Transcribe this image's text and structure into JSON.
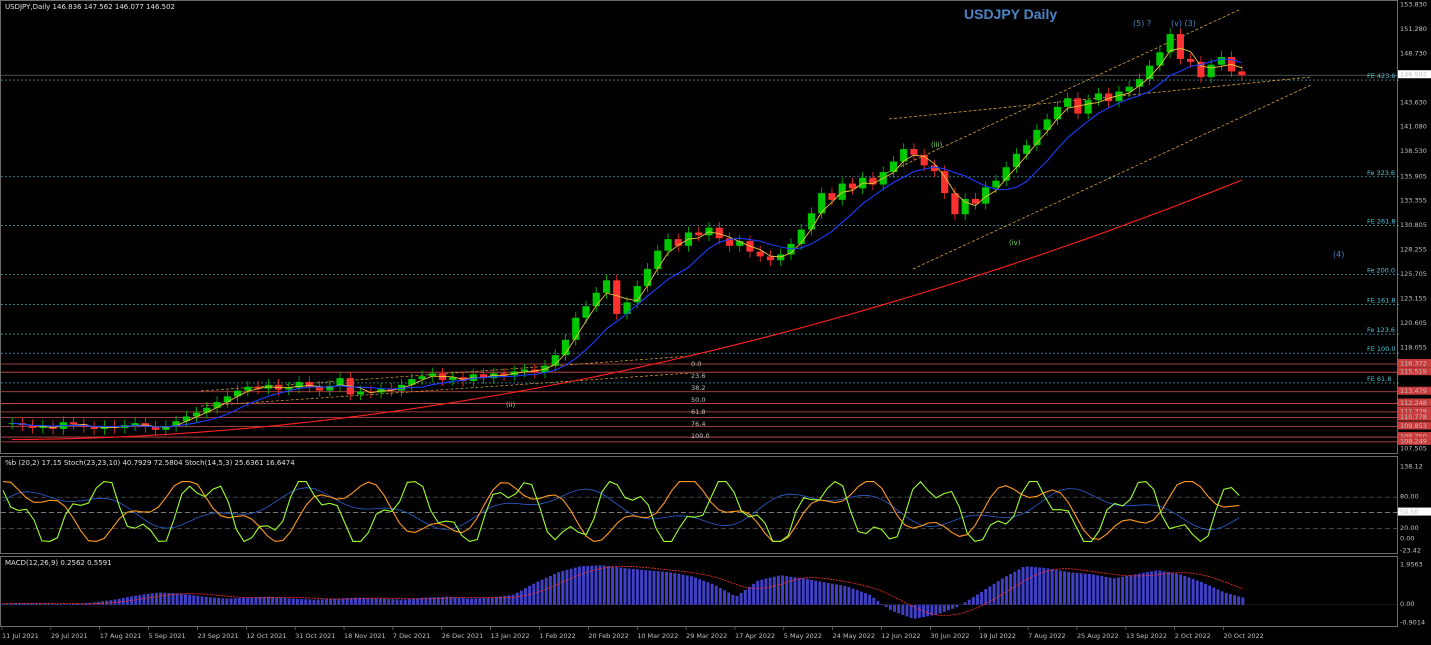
{
  "header": {
    "symbol_line": "USDJPY,Daily  146.836 147.562 146.077 146.502",
    "chart_title": "USDJPY Daily",
    "current_price": "146.502"
  },
  "stoch_header": "%b (20,2) 17.15  Stoch(23,23,10) 40.7929 72.5804  Stoch(14,5,3) 25.6361 16.6474",
  "macd_header": "MACD(12,26,9) 0.2562 0.5591",
  "wave_labels": [
    "(5) ?",
    "(v) (3)",
    "(iii)",
    "(iv)",
    "(4)",
    "(ii)"
  ],
  "colors": {
    "background": "#000000",
    "bull_candle": "#00c800",
    "bear_candle": "#ff3030",
    "ma_blue": "#1e3cff",
    "ma_red": "#ff2020",
    "ma_yellow": "#e8c43a",
    "fib_cyan": "#4fc7d8",
    "channel_orange": "#d9a43a",
    "stoch_green": "#9eff2e",
    "stoch_orange": "#ff9a1e",
    "macd_hist": "#4040c8"
  },
  "chart_data": [
    {
      "type": "candlestick",
      "title": "USDJPY Daily",
      "price_axis_ticks": [
        "153.830",
        "151.280",
        "148.730",
        "146.502",
        "143.630",
        "141.080",
        "138.530",
        "135.905",
        "133.355",
        "130.805",
        "128.255",
        "125.705",
        "123.155",
        "120.605",
        "118.055",
        "116.372",
        "115.519",
        "113.479",
        "112.248",
        "111.379",
        "110.778",
        "109.853",
        "108.750",
        "108.249",
        "107.505"
      ],
      "time_axis_ticks": [
        "11 Jul 2021",
        "29 Jul 2021",
        "17 Aug 2021",
        "5 Sep 2021",
        "23 Sep 2021",
        "12 Oct 2021",
        "31 Oct 2021",
        "18 Nov 2021",
        "7 Dec 2021",
        "26 Dec 2021",
        "13 Jan 2022",
        "1 Feb 2022",
        "20 Feb 2022",
        "10 Mar 2022",
        "29 Mar 2022",
        "17 Apr 2022",
        "5 May 2022",
        "24 May 2022",
        "12 Jun 2022",
        "30 Jun 2022",
        "19 Jul 2022",
        "7 Aug 2022",
        "25 Aug 2022",
        "13 Sep 2022",
        "2 Oct 2022",
        "20 Oct 2022"
      ],
      "fib_levels": [
        {
          "label": "FE 423.6",
          "price": 146.0
        },
        {
          "label": "Fe 323.6",
          "price": 135.9
        },
        {
          "label": "FE 261.8",
          "price": 130.8
        },
        {
          "label": "Fe 200.0",
          "price": 125.7
        },
        {
          "label": "FE 161.8",
          "price": 122.6
        },
        {
          "label": "Fe 123.6",
          "price": 119.5
        },
        {
          "label": "FE 100.0",
          "price": 117.5
        },
        {
          "label": "FE 61.8",
          "price": 114.4
        }
      ],
      "retracement_labels": [
        "0.0",
        "23.6",
        "38.2",
        "50.0",
        "61.8",
        "76.4",
        "100.0"
      ],
      "ohlc_close": [
        110.2,
        110.0,
        109.7,
        109.9,
        109.6,
        110.3,
        110.1,
        109.8,
        109.6,
        109.9,
        109.7,
        110.0,
        110.2,
        109.8,
        109.5,
        109.9,
        110.4,
        110.9,
        111.3,
        111.8,
        112.4,
        113.0,
        113.6,
        114.0,
        113.8,
        114.2,
        113.7,
        113.9,
        114.5,
        114.0,
        113.6,
        114.1,
        114.9,
        113.2,
        113.5,
        113.4,
        113.8,
        113.6,
        114.2,
        114.8,
        115.1,
        115.4,
        114.7,
        115.0,
        114.6,
        115.3,
        114.9,
        115.4,
        115.2,
        115.6,
        115.8,
        115.5,
        116.2,
        117.3,
        118.9,
        121.2,
        122.4,
        123.8,
        125.1,
        121.6,
        122.8,
        124.5,
        126.3,
        128.2,
        129.4,
        128.7,
        130.1,
        129.8,
        130.6,
        129.5,
        128.7,
        129.2,
        128.1,
        127.6,
        127.2,
        127.8,
        128.9,
        130.4,
        132.1,
        134.2,
        133.5,
        135.2,
        134.7,
        135.8,
        135.1,
        136.4,
        137.5,
        138.8,
        138.2,
        137.1,
        136.5,
        134.2,
        132.0,
        133.6,
        133.1,
        134.8,
        135.5,
        136.9,
        138.3,
        139.2,
        140.8,
        141.9,
        143.2,
        144.1,
        142.5,
        143.9,
        144.6,
        143.8,
        144.8,
        145.3,
        146.1,
        147.5,
        148.9,
        150.8,
        148.2,
        147.9,
        146.3,
        147.6,
        148.4,
        146.9,
        146.5
      ]
    },
    {
      "type": "line",
      "title": "%b (20,2) 17.15  Stoch(23,23,10) 40.7929 72.5804  Stoch(14,5,3) 25.6361 16.6474",
      "axis_ticks": [
        "138.12",
        "80.00",
        "50.50",
        "20.00",
        "0.00",
        "-23.42"
      ]
    },
    {
      "type": "bar",
      "title": "MACD(12,26,9) 0.2562 0.5591",
      "axis_ticks": [
        "1.9563",
        "0.00",
        "-0.9014"
      ],
      "histogram_profile": [
        0.05,
        0.08,
        0.05,
        0.02,
        0.1,
        0.25,
        0.45,
        0.6,
        0.55,
        0.4,
        0.3,
        0.35,
        0.4,
        0.3,
        0.25,
        0.3,
        0.35,
        0.3,
        0.25,
        0.35,
        0.4,
        0.3,
        0.35,
        0.5,
        1.1,
        1.6,
        1.9,
        1.95,
        1.8,
        1.7,
        1.6,
        1.4,
        1.0,
        0.4,
        1.2,
        1.45,
        1.3,
        1.1,
        0.9,
        0.5,
        -0.3,
        -0.7,
        -0.5,
        -0.1,
        0.6,
        1.3,
        1.9,
        1.8,
        1.6,
        1.5,
        1.3,
        1.5,
        1.7,
        1.5,
        1.1,
        0.6,
        0.3
      ]
    }
  ]
}
